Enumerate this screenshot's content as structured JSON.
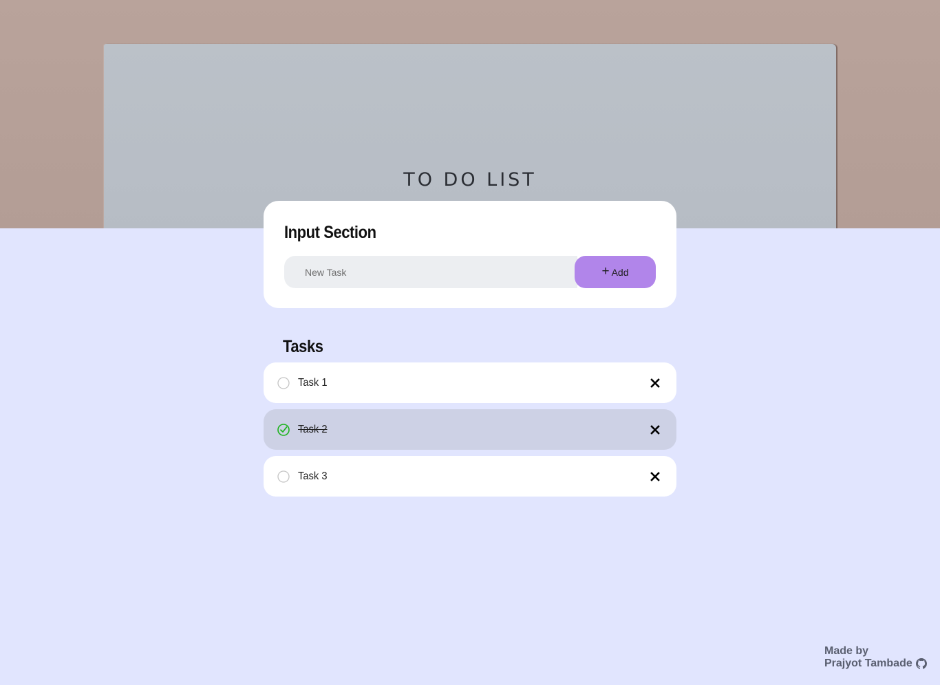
{
  "hero": {
    "paper_title": "TO DO LIST"
  },
  "input_section": {
    "title": "Input Section",
    "placeholder": "New Task",
    "value": "",
    "add_label": "Add"
  },
  "tasks_section": {
    "title": "Tasks",
    "items": [
      {
        "label": "Task 1",
        "completed": false
      },
      {
        "label": "Task 2",
        "completed": true
      },
      {
        "label": "Task 3",
        "completed": false
      }
    ]
  },
  "footer": {
    "made_by": "Made by",
    "author": "Prajyot Tambade"
  },
  "colors": {
    "page_bg": "#e1e5fe",
    "accent": "#b185ea",
    "done_bg": "#cdd1e5",
    "check_green": "#1db31d"
  },
  "icons": {
    "add": "plus-icon",
    "unchecked": "circle-outline-icon",
    "checked": "check-circle-icon",
    "delete": "close-icon",
    "footer": "github-icon"
  }
}
